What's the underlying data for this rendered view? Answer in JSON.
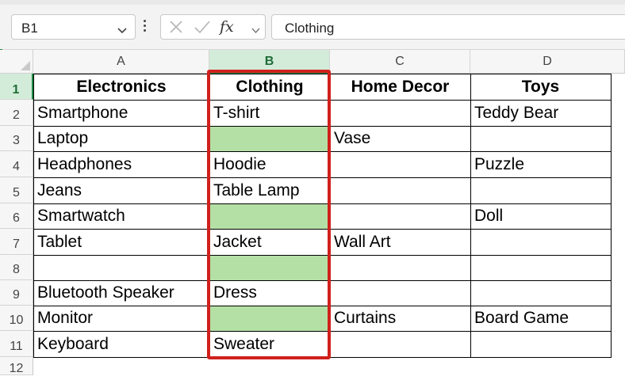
{
  "formula_bar": {
    "name_box": "B1",
    "fx_label": "fx",
    "formula": "Clothing"
  },
  "columns": [
    "A",
    "B",
    "C",
    "D"
  ],
  "rows": [
    "1",
    "2",
    "3",
    "4",
    "5",
    "6",
    "7",
    "8",
    "9",
    "10",
    "11",
    "12"
  ],
  "cells": {
    "r1": {
      "A": "Electronics",
      "B": "Clothing",
      "C": "Home Decor",
      "D": "Toys"
    },
    "r2": {
      "A": "Smartphone",
      "B": "T-shirt",
      "C": "",
      "D": "Teddy Bear"
    },
    "r3": {
      "A": "Laptop",
      "B": "",
      "C": "Vase",
      "D": ""
    },
    "r4": {
      "A": "Headphones",
      "B": "Hoodie",
      "C": "",
      "D": "Puzzle"
    },
    "r5": {
      "A": "Jeans",
      "B": "Table Lamp",
      "C": "",
      "D": ""
    },
    "r6": {
      "A": "Smartwatch",
      "B": "",
      "C": "",
      "D": "Doll"
    },
    "r7": {
      "A": "Tablet",
      "B": "Jacket",
      "C": "Wall Art",
      "D": ""
    },
    "r8": {
      "A": "",
      "B": "",
      "C": "",
      "D": ""
    },
    "r9": {
      "A": "Bluetooth Speaker",
      "B": "Dress",
      "C": "",
      "D": ""
    },
    "r10": {
      "A": "Monitor",
      "B": "",
      "C": "Curtains",
      "D": "Board Game"
    },
    "r11": {
      "A": "Keyboard",
      "B": "Sweater",
      "C": "",
      "D": ""
    }
  },
  "colors": {
    "accent_green": "#1f8a45",
    "empty_highlight": "#b4e0a6",
    "annotation_red": "#d0201c"
  },
  "icons": [
    "chevron-down-icon",
    "more-options-icon",
    "cancel-icon",
    "enter-check-icon",
    "function-icon"
  ]
}
